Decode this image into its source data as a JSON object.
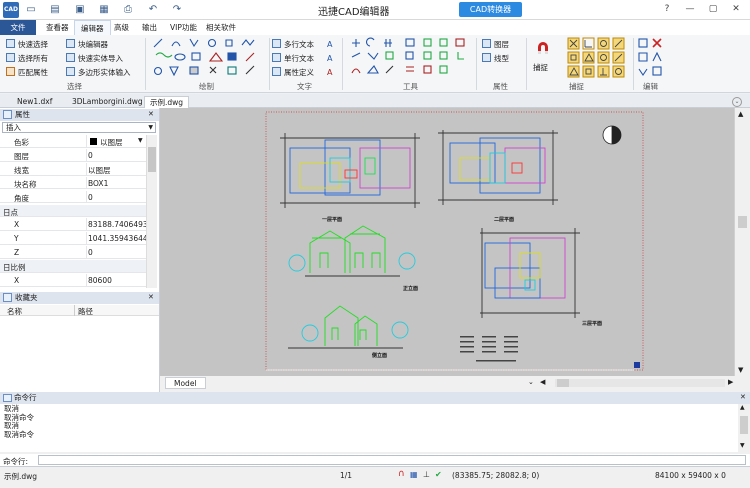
{
  "titlebar": {
    "app_title": "迅捷CAD编辑器",
    "converter_label": "CAD转换器"
  },
  "menus": [
    "文件",
    "查看器",
    "编辑器",
    "高级",
    "输出",
    "VIP功能",
    "相关软件"
  ],
  "ribbon": {
    "select_group": {
      "items": [
        "快速选择",
        "选择所有",
        "匹配属性",
        "块编辑器",
        "快速实体导入",
        "多边形实体输入"
      ],
      "label": "选择"
    },
    "draw_group": {
      "label": "绘制"
    },
    "text_group": {
      "items": [
        "多行文本",
        "单行文本",
        "属性定义"
      ],
      "label": "文字"
    },
    "tools_group": {
      "label": "工具"
    },
    "props_group": {
      "items": [
        "图层",
        "线型"
      ],
      "label": "属性"
    },
    "snap_group": {
      "button": "捕捉",
      "label": "捕捉"
    },
    "edit_group": {
      "label": "编辑"
    }
  },
  "doc_tabs": [
    "New1.dxf",
    "3DLamborgini.dwg",
    "示例.dwg"
  ],
  "properties": {
    "title": "属性",
    "dropdown": "插入",
    "rows": [
      {
        "k": "色彩",
        "v": "以图层",
        "cat": false,
        "swatch": true
      },
      {
        "k": "图层",
        "v": "0",
        "cat": false
      },
      {
        "k": "线宽",
        "v": "以图层",
        "cat": false
      },
      {
        "k": "块名称",
        "v": "BOX1",
        "cat": false
      },
      {
        "k": "角度",
        "v": "0",
        "cat": false
      },
      {
        "k": "日点",
        "v": "",
        "cat": true
      },
      {
        "k": "X",
        "v": "83188.740649304",
        "cat": false
      },
      {
        "k": "Y",
        "v": "1041.35943644",
        "cat": false
      },
      {
        "k": "Z",
        "v": "0",
        "cat": false
      },
      {
        "k": "日比例",
        "v": "",
        "cat": true
      },
      {
        "k": "X",
        "v": "80600",
        "cat": false
      }
    ]
  },
  "favorites": {
    "title": "收藏夹",
    "col_name": "名称",
    "col_path": "路径"
  },
  "drawing": {
    "label_floor1": "一层平面",
    "label_floor2": "二层平面",
    "label_elev_front": "正立面",
    "label_elev_side": "侧立面",
    "label_floor3": "三层平面",
    "model_tab": "Model"
  },
  "command": {
    "title": "命令行",
    "log": [
      "取消",
      "取消命令",
      "取消",
      "取消命令"
    ],
    "input_label": "命令行:"
  },
  "status": {
    "file": "示例.dwg",
    "page": "1/1",
    "coords": "(83385.75; 28082.8; 0)",
    "size": "84100 x 59400 x 0"
  }
}
